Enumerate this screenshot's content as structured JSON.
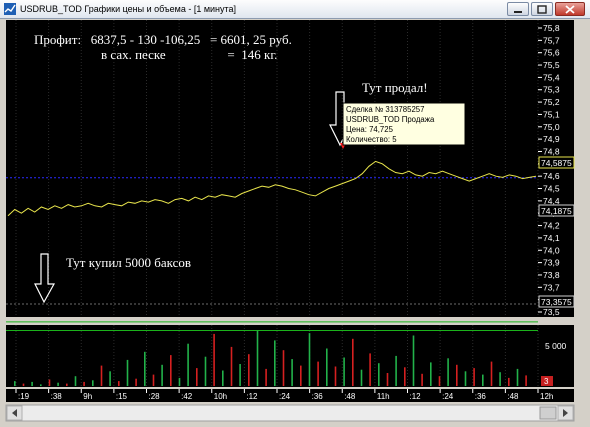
{
  "window": {
    "title": "USDRUB_TOD Графики цены и объема - [1 минута]"
  },
  "colors": {
    "background": "#000000",
    "price_line": "#e8e44c",
    "blue_level": "#2a2aff",
    "green_level": "#1bb21b",
    "volume_up": "#22b24a",
    "volume_down": "#d62020",
    "axis_text": "#ffffff",
    "tooltip_bg": "#ffffe1",
    "marker": "#ff1f1f"
  },
  "annotations": {
    "profit_line1": "Профит:   6837,5 - 130 -106,25   = 6601, 25 руб.",
    "profit_line2": "в сах. песке                   =  146 кг.",
    "sold_label": "Тут продал!",
    "bought_label": "Тут купил 5000 баксов"
  },
  "tooltip": {
    "line1": "Сделка № 313785257",
    "line2": "USDRUB_TOD Продажа",
    "line3": "Цена: 74,725",
    "line4": "Количество: 5"
  },
  "price_axis_labels": [
    "75,8",
    "75,7",
    "75,6",
    "75,5",
    "75,4",
    "75,3",
    "75,2",
    "75,1",
    "75,0",
    "74,9",
    "74,8",
    "74,7",
    "74,6",
    "74,5",
    "74,4",
    "74,3",
    "74,2",
    "74,1",
    "74,0",
    "73,9",
    "73,8",
    "73,7",
    "73,6",
    "73,5"
  ],
  "price_boxes": {
    "current": "74,5875",
    "blue_level": "74,1875",
    "green_level": "73,3575"
  },
  "volume_axis": {
    "label": "5 000",
    "box": "3"
  },
  "time_labels": [
    ":19",
    ":38",
    "9h",
    ":15",
    ":28",
    ":42",
    "10h",
    ":12",
    ":24",
    ":36",
    ":48",
    "11h",
    ":12",
    ":24",
    ":36",
    ":48",
    "12h"
  ],
  "chart_data": {
    "type": "line",
    "blue_level": 74.5875,
    "green_levels": [
      73.42,
      73.35
    ],
    "sell_marker": {
      "price": 74.725
    },
    "price": [
      74.28,
      74.33,
      74.3,
      74.34,
      74.31,
      74.35,
      74.33,
      74.36,
      74.34,
      74.37,
      74.35,
      74.36,
      74.38,
      74.36,
      74.35,
      74.38,
      74.37,
      74.36,
      74.39,
      74.38,
      74.4,
      74.39,
      74.41,
      74.4,
      74.38,
      74.41,
      74.42,
      74.4,
      74.43,
      74.41,
      74.44,
      74.43,
      74.45,
      74.44,
      74.43,
      74.46,
      74.48,
      74.5,
      74.52,
      74.51,
      74.53,
      74.52,
      74.5,
      74.49,
      74.47,
      74.45,
      74.44,
      74.47,
      74.5,
      74.52,
      74.54,
      74.56,
      74.58,
      74.62,
      74.68,
      74.72,
      74.7,
      74.66,
      74.63,
      74.62,
      74.64,
      74.61,
      74.6,
      74.63,
      74.62,
      74.64,
      74.62,
      74.6,
      74.58,
      74.56,
      74.58,
      74.6,
      74.62,
      74.6,
      74.59,
      74.61,
      74.6,
      74.58,
      74.59,
      74.6
    ],
    "volume": [
      {
        "v": 600,
        "up": true
      },
      {
        "v": 300,
        "up": false
      },
      {
        "v": 500,
        "up": true
      },
      {
        "v": 200,
        "up": true
      },
      {
        "v": 800,
        "up": false
      },
      {
        "v": 400,
        "up": true
      },
      {
        "v": 300,
        "up": false
      },
      {
        "v": 1200,
        "up": true
      },
      {
        "v": 500,
        "up": false
      },
      {
        "v": 700,
        "up": true
      },
      {
        "v": 2500,
        "up": false
      },
      {
        "v": 1800,
        "up": true
      },
      {
        "v": 600,
        "up": false
      },
      {
        "v": 3200,
        "up": true
      },
      {
        "v": 900,
        "up": false
      },
      {
        "v": 4200,
        "up": true
      },
      {
        "v": 1400,
        "up": false
      },
      {
        "v": 2600,
        "up": true
      },
      {
        "v": 3800,
        "up": false
      },
      {
        "v": 1000,
        "up": true
      },
      {
        "v": 5200,
        "up": true
      },
      {
        "v": 2200,
        "up": false
      },
      {
        "v": 3600,
        "up": true
      },
      {
        "v": 6400,
        "up": false
      },
      {
        "v": 1900,
        "up": true
      },
      {
        "v": 4800,
        "up": false
      },
      {
        "v": 2700,
        "up": true
      },
      {
        "v": 3900,
        "up": false
      },
      {
        "v": 6800,
        "up": true
      },
      {
        "v": 2100,
        "up": false
      },
      {
        "v": 5600,
        "up": true
      },
      {
        "v": 4400,
        "up": false
      },
      {
        "v": 3300,
        "up": true
      },
      {
        "v": 2500,
        "up": false
      },
      {
        "v": 6500,
        "up": true
      },
      {
        "v": 3000,
        "up": false
      },
      {
        "v": 4600,
        "up": true
      },
      {
        "v": 2400,
        "up": false
      },
      {
        "v": 3500,
        "up": true
      },
      {
        "v": 5800,
        "up": false
      },
      {
        "v": 2000,
        "up": true
      },
      {
        "v": 4000,
        "up": false
      },
      {
        "v": 2800,
        "up": true
      },
      {
        "v": 1600,
        "up": false
      },
      {
        "v": 3700,
        "up": true
      },
      {
        "v": 2300,
        "up": false
      },
      {
        "v": 6200,
        "up": true
      },
      {
        "v": 1500,
        "up": false
      },
      {
        "v": 2900,
        "up": true
      },
      {
        "v": 1200,
        "up": false
      },
      {
        "v": 3400,
        "up": true
      },
      {
        "v": 2600,
        "up": false
      },
      {
        "v": 1800,
        "up": true
      },
      {
        "v": 2200,
        "up": false
      },
      {
        "v": 1400,
        "up": true
      },
      {
        "v": 3000,
        "up": false
      },
      {
        "v": 1700,
        "up": true
      },
      {
        "v": 1000,
        "up": false
      },
      {
        "v": 2100,
        "up": true
      },
      {
        "v": 1300,
        "up": false
      }
    ]
  }
}
